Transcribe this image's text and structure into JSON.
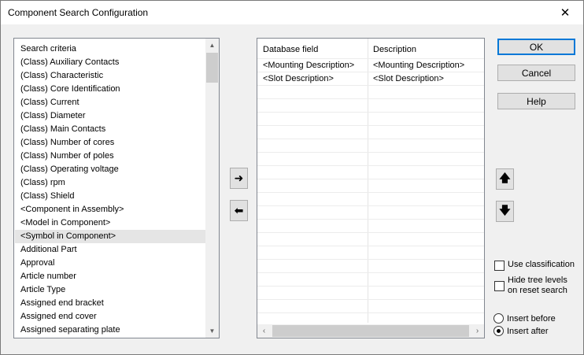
{
  "window": {
    "title": "Component Search Configuration",
    "close_glyph": "✕"
  },
  "criteria_list": {
    "items": [
      "Search criteria",
      "(Class) Auxiliary Contacts",
      "(Class) Characteristic",
      "(Class) Core Identification",
      "(Class) Current",
      "(Class) Diameter",
      "(Class) Main Contacts",
      "(Class) Number of cores",
      "(Class) Number of poles",
      "(Class) Operating voltage",
      "(Class) rpm",
      "(Class) Shield",
      "<Component in Assembly>",
      "<Model in Component>",
      "<Symbol in Component>",
      "Additional Part",
      "Approval",
      "Article number",
      "Article Type",
      "Assigned end bracket",
      "Assigned end cover",
      "Assigned separating plate"
    ],
    "selected_index": 14
  },
  "move_buttons": {
    "add_glyph": "➜",
    "remove_glyph": "⬅"
  },
  "fields_table": {
    "columns": [
      "Database field",
      "Description"
    ],
    "rows": [
      [
        "<Mounting Description>",
        "<Mounting Description>"
      ],
      [
        "<Slot Description>",
        "<Slot Description>"
      ]
    ]
  },
  "order_buttons": {
    "up_glyph": "🡅",
    "down_glyph": "🡇"
  },
  "buttons": {
    "ok": "OK",
    "cancel": "Cancel",
    "help": "Help"
  },
  "options": {
    "use_classification": "Use classification",
    "hide_tree_levels_line1": "Hide tree levels",
    "hide_tree_levels_line2": "on reset search",
    "insert_before": "Insert before",
    "insert_after": "Insert after",
    "selected_insert": "after"
  }
}
